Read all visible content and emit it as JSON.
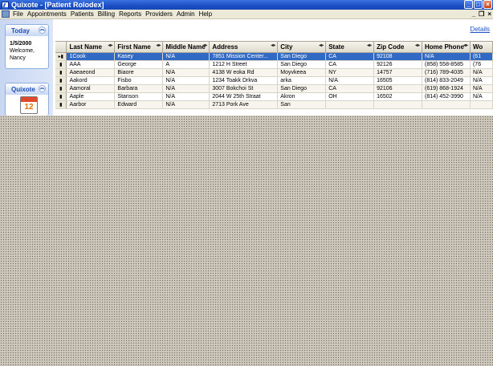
{
  "window": {
    "title": "Quixote - [Patient Rolodex]"
  },
  "menu": {
    "items": [
      "File",
      "Appointments",
      "Patients",
      "Billing",
      "Reports",
      "Providers",
      "Admin",
      "Help"
    ]
  },
  "sidebar": {
    "today": {
      "title": "Today",
      "date": "1/5/2000",
      "welcome": "Welcome,",
      "user": "Nancy"
    },
    "quixote": {
      "title": "Quixote",
      "calendar_day": "12"
    }
  },
  "main": {
    "details_label": "Details",
    "columns": [
      "Last Name",
      "First Name",
      "Middle Name",
      "Address",
      "City",
      "State",
      "Zip Code",
      "Home Phone",
      "Wo"
    ],
    "rows": [
      [
        "1Cook",
        "Kasey",
        "N/A",
        "7851 Mission Center...",
        "San Diego",
        "CA",
        "92108",
        "N/A",
        "(61"
      ],
      [
        "AAA",
        "George",
        "A",
        "1212 H Street",
        "San Diego",
        "CA",
        "92126",
        "(858) 558-8585",
        "(76"
      ],
      [
        "Aaeaeond",
        "Biaore",
        "N/A",
        "4138 W eoka Rd",
        "Moyvkeea",
        "NY",
        "14757",
        "(716) 789-4035",
        "N/A"
      ],
      [
        "Aakord",
        "Fisbo",
        "N/A",
        "1234 Toakk Drkva",
        "arka",
        "N/A",
        "16505",
        "(814) 833-2049",
        "N/A"
      ],
      [
        "Aamoral",
        "Barbara",
        "N/A",
        "3007 Bokchoi St",
        "San Diego",
        "CA",
        "92106",
        "(619) 868-1924",
        "N/A"
      ],
      [
        "Aaple",
        "Stanson",
        "N/A",
        "2044 W  25th Straat",
        "Akron",
        "OH",
        "16502",
        "(814) 452-3990",
        "N/A"
      ],
      [
        "Aarbor",
        "Edward",
        "N/A",
        "2713 Pork Ave",
        "San",
        "",
        "",
        "",
        ""
      ]
    ]
  },
  "colors": {
    "titlebar": "#1c4fc4",
    "selection": "#316ac5",
    "link": "#1c4fc4"
  }
}
